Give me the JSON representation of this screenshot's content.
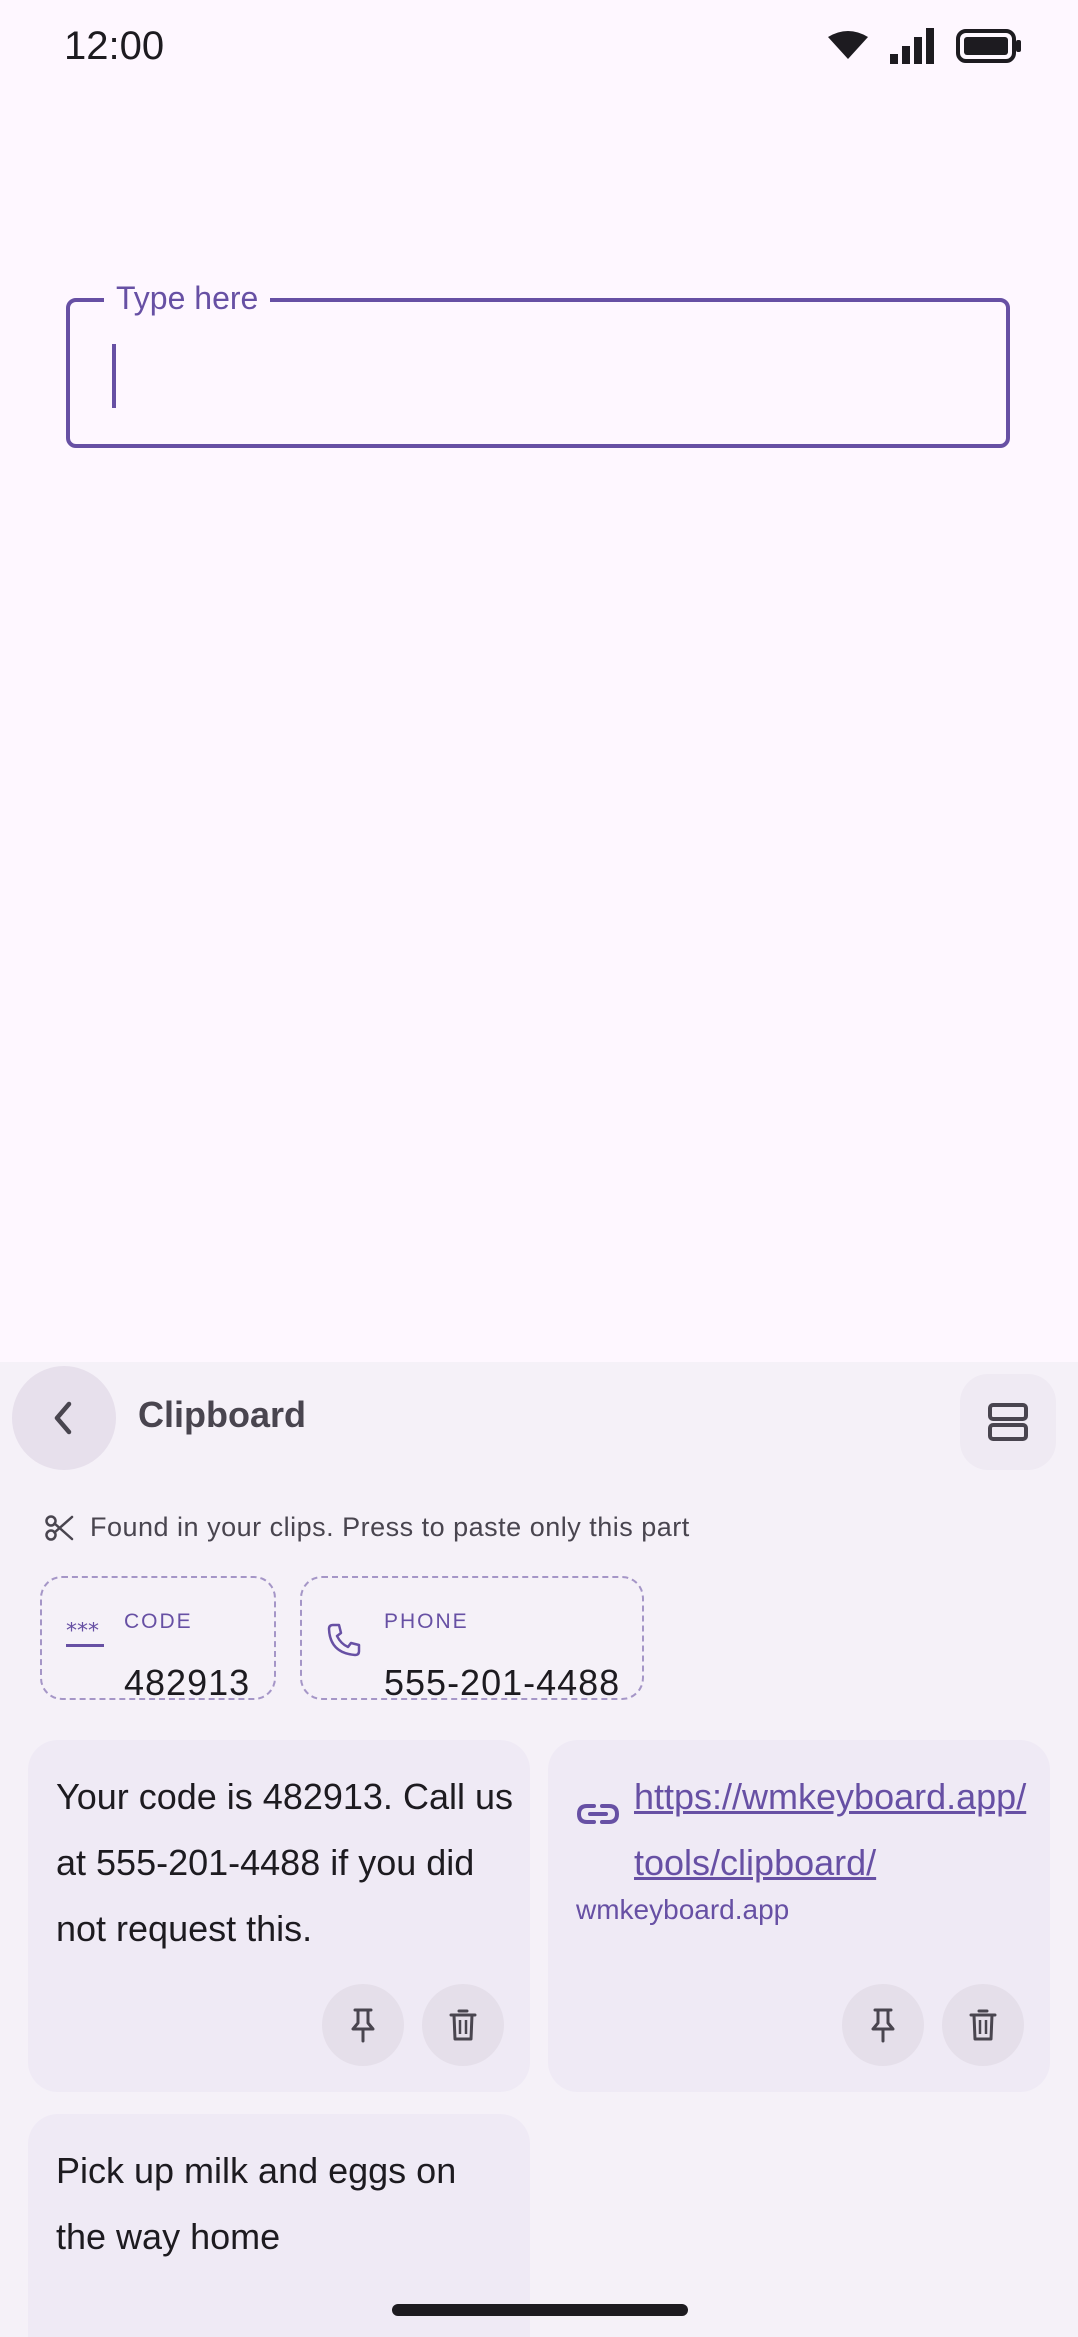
{
  "status_bar": {
    "time": "12:00"
  },
  "text_field": {
    "label": "Type here",
    "value": ""
  },
  "clipboard": {
    "title": "Clipboard",
    "hint": "Found in your clips. Press to paste only this part",
    "chips": [
      {
        "label": "CODE",
        "value": "482913",
        "icon": "asterisks-icon"
      },
      {
        "label": "PHONE",
        "value": "555-201-4488",
        "icon": "phone-icon"
      }
    ],
    "clips": [
      {
        "text": "Your code is 482913. Call us at 555-201-4488 if you did not request this."
      },
      {
        "link": "https://wmkeyboard.app/tools/clipboard/",
        "domain": "wmkeyboard.app"
      },
      {
        "text": "Pick up milk and eggs on the way home"
      }
    ]
  },
  "colors": {
    "accent": "#6750A4",
    "background": "#FEF7FF",
    "panel": "#F5F1F8"
  }
}
